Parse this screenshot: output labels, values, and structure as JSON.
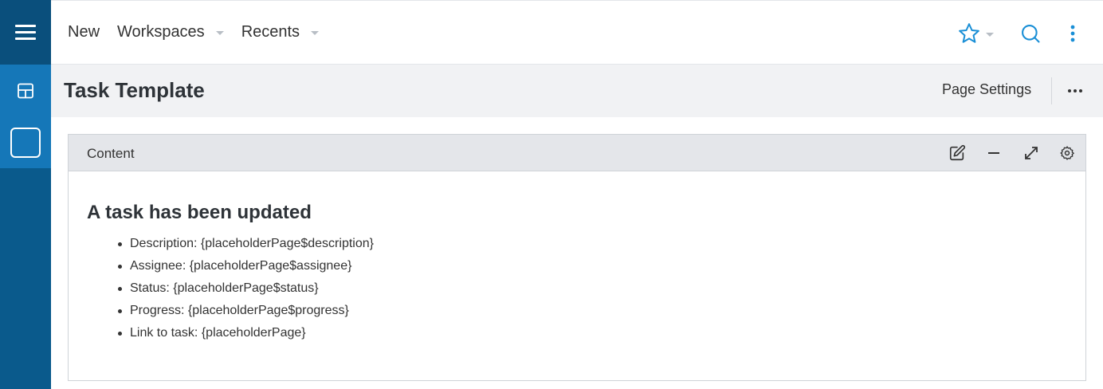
{
  "nav": {
    "new_label": "New",
    "workspaces_label": "Workspaces",
    "recents_label": "Recents"
  },
  "icons": {
    "menu": "hamburger-menu-icon",
    "layout": "layout-icon",
    "page": "page-icon",
    "favorite": "star-icon",
    "search": "search-icon",
    "more_vertical": "more-vertical-icon",
    "more_horizontal": "more-horizontal-icon",
    "edit": "edit-icon",
    "minimize": "minimize-icon",
    "expand": "expand-icon",
    "settings": "gear-icon"
  },
  "page": {
    "title": "Task Template",
    "settings_label": "Page Settings"
  },
  "panel": {
    "title": "Content",
    "heading": "A task has been updated",
    "items": [
      "Description: {placeholderPage$description}",
      "Assignee: {placeholderPage$assignee}",
      "Status: {placeholderPage$status}",
      "Progress: {placeholderPage$progress}",
      "Link to task: {placeholderPage}"
    ]
  },
  "colors": {
    "rail": "#0a5a8c",
    "rail_selected": "#1577b8",
    "accent": "#1a8fd6"
  }
}
